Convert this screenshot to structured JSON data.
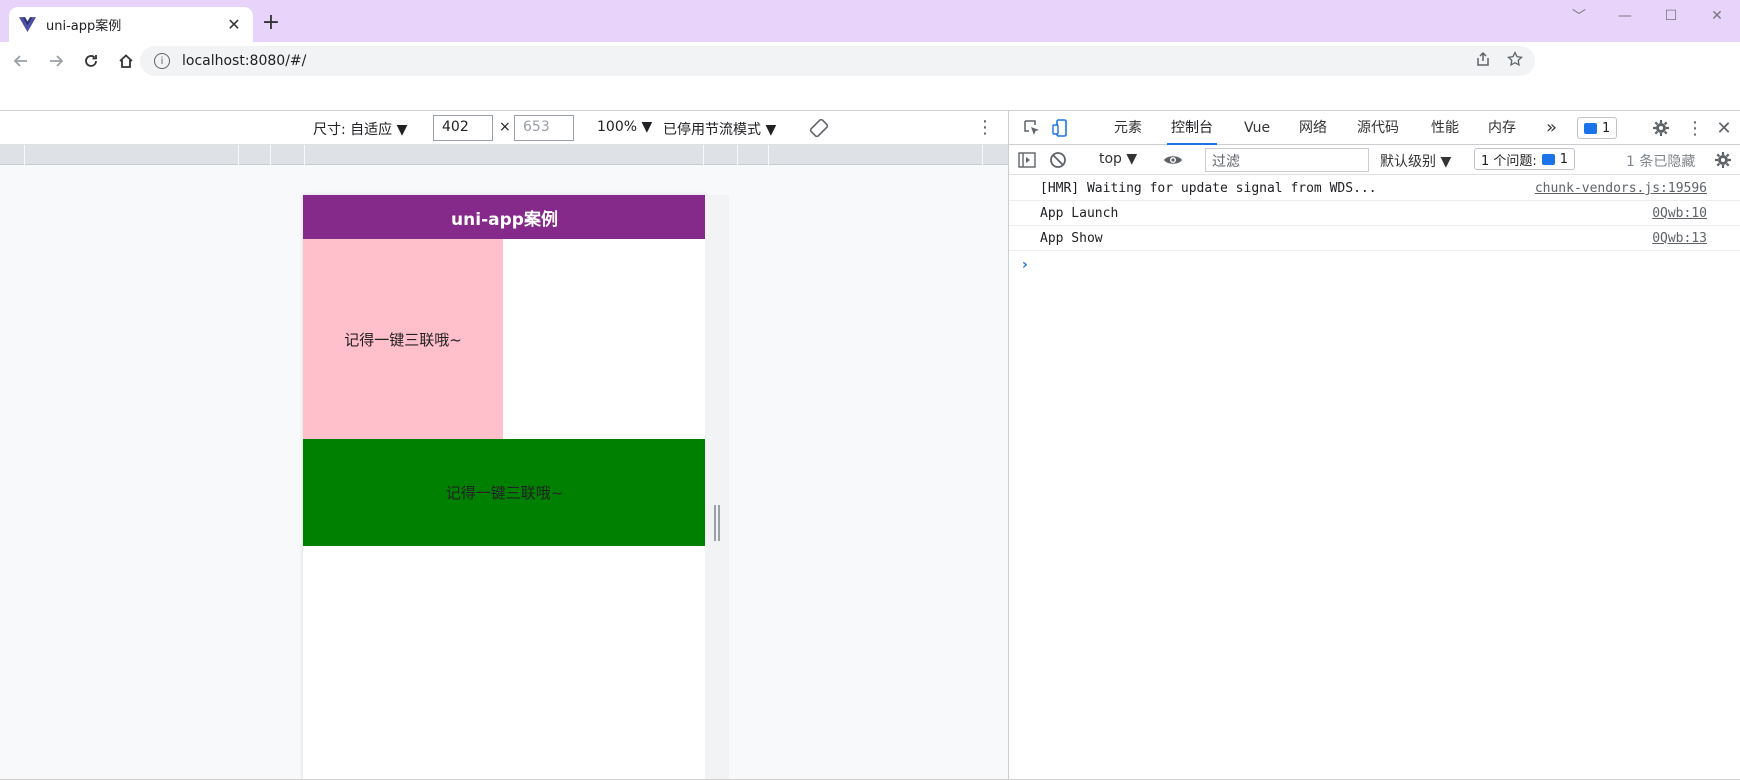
{
  "browser": {
    "tab": {
      "title": "uni-app案例",
      "close": "✕"
    },
    "new_tab": "+",
    "window_controls": {
      "collapse": "﹀",
      "minimize": "—",
      "maximize": "☐",
      "close": "✕"
    },
    "url": "localhost:8080/#/"
  },
  "device_toolbar": {
    "size_label": "尺寸: 自适应 ▼",
    "width_value": "402",
    "times": "×",
    "height_placeholder": "653",
    "zoom_label": "100% ▼",
    "throttle_label": "已停用节流模式 ▼"
  },
  "app": {
    "header_title": "uni-app案例",
    "pink_text": "记得一键三联哦~",
    "green_text": "记得一键三联哦~",
    "colors": {
      "header": "#852a8b",
      "pink": "#ffc0cb",
      "green": "#008000"
    }
  },
  "devtools": {
    "tabs": [
      "元素",
      "控制台",
      "Vue",
      "网络",
      "源代码",
      "性能",
      "内存"
    ],
    "active_tab": "控制台",
    "more": "»",
    "issue_count": "1",
    "console": {
      "context": "top ▼",
      "filter_placeholder": "过滤",
      "level": "默认级别 ▼",
      "issues": "1 个问题:",
      "issues_count": "1",
      "hidden": "1 条已隐藏"
    },
    "logs": [
      {
        "message": "[HMR] Waiting for update signal from WDS...",
        "source": "chunk-vendors.js:19596"
      },
      {
        "message": "App Launch",
        "source": "0Qwb:10"
      },
      {
        "message": "App Show",
        "source": "0Qwb:13"
      }
    ],
    "prompt": "›"
  }
}
